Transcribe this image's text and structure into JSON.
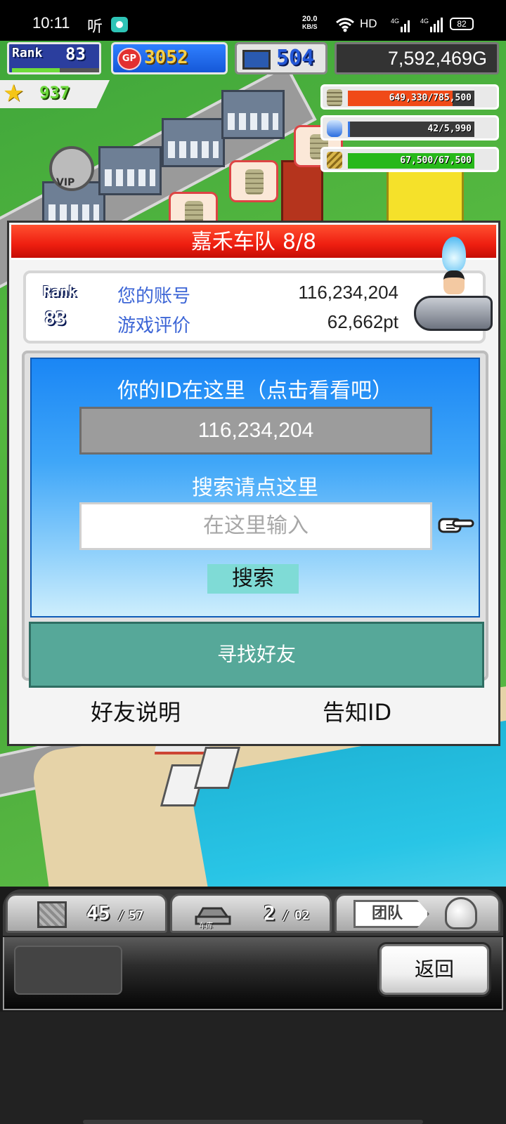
{
  "status_bar": {
    "time": "10:11",
    "app_icon_text": "听",
    "speed_value": "20.0",
    "speed_unit": "KB/S",
    "network_label": "HD",
    "signal1_label": "4G",
    "signal2_label": "4G",
    "battery": "82"
  },
  "hud": {
    "rank_label": "Rank",
    "rank": "83",
    "rank_progress": 0.55,
    "gp": "3052",
    "gp_icon": "GP",
    "research": "504",
    "money": "7,592,469G",
    "stars": "937",
    "resources": [
      {
        "icon": "coin-stack-icon",
        "text": "649,330/785,500",
        "fill": 0.827,
        "color": "#f04a18"
      },
      {
        "icon": "fuel-bottle-icon",
        "text": "42/5,990",
        "fill": 0.007,
        "color": "#3a7ae8"
      },
      {
        "icon": "wheat-icon",
        "text": "67,500/67,500",
        "fill": 1.0,
        "color": "#27b81a"
      }
    ]
  },
  "dialog": {
    "team_name": "嘉禾车队",
    "team_count": "8/8",
    "rank_label": "Rank",
    "rank": "83",
    "account_label": "您的账号",
    "account_value": "116,234,204",
    "rating_label": "游戏评价",
    "rating_value": "62,662pt",
    "id_hint": "你的ID在这里（点击看看吧）",
    "id_value": "116,234,204",
    "search_hint": "搜索请点这里",
    "search_placeholder": "在这里输入",
    "search_button": "搜索",
    "find_friends_button": "寻找好友",
    "friends_help_link": "好友说明",
    "notify_id_link": "告知ID"
  },
  "bottom_hud": {
    "storage_count": "45",
    "storage_max": "57",
    "garage_label": "车库",
    "garage_count": "2",
    "garage_max": "02",
    "team_button": "团队",
    "back_button": "返回"
  }
}
